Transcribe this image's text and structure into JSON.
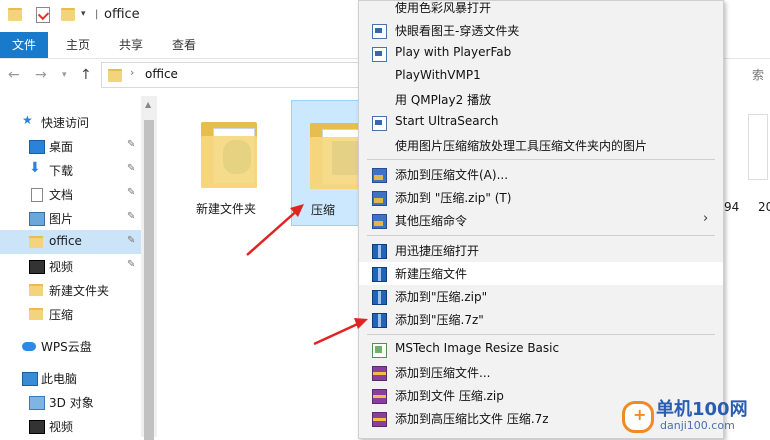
{
  "window": {
    "title": "office"
  },
  "ribbon": {
    "tabs": [
      "文件",
      "主页",
      "共享",
      "查看"
    ]
  },
  "address": {
    "path": "office",
    "search_fragment": "索"
  },
  "nav": {
    "items": [
      {
        "label": "快速访问",
        "icon": "star-icon"
      },
      {
        "label": "桌面",
        "icon": "desktop-icon",
        "pinned": true
      },
      {
        "label": "下载",
        "icon": "download-icon",
        "pinned": true
      },
      {
        "label": "文档",
        "icon": "document-icon",
        "pinned": true
      },
      {
        "label": "图片",
        "icon": "picture-icon",
        "pinned": true
      },
      {
        "label": "office",
        "icon": "folder-icon",
        "pinned": true,
        "selected": true
      },
      {
        "label": "视频",
        "icon": "video-icon",
        "pinned": true
      },
      {
        "label": "新建文件夹",
        "icon": "folder-icon"
      },
      {
        "label": "压缩",
        "icon": "folder-icon"
      },
      {
        "label": "WPS云盘",
        "icon": "cloud-icon"
      },
      {
        "label": "此电脑",
        "icon": "computer-icon"
      },
      {
        "label": "3D 对象",
        "icon": "3d-objects-icon"
      },
      {
        "label": "视频",
        "icon": "video-icon"
      }
    ]
  },
  "files": [
    {
      "name": "新建文件夹",
      "selected": false
    },
    {
      "name": "压缩",
      "selected": true
    }
  ],
  "edge_labels": [
    "94",
    "20"
  ],
  "context_menu": {
    "items": [
      {
        "label": "使用色彩风暴打开",
        "icon": "none"
      },
      {
        "label": "快眼看图王-穿透文件夹",
        "icon": "app-icon"
      },
      {
        "label": "Play with PlayerFab",
        "icon": "app-icon"
      },
      {
        "label": "PlayWithVMP1",
        "icon": "none"
      },
      {
        "label": "用 QMPlay2 播放",
        "icon": "none"
      },
      {
        "label": "Start UltraSearch",
        "icon": "app-icon"
      },
      {
        "label": "使用图片压缩缩放处理工具压缩文件夹内的图片",
        "icon": "none"
      },
      {
        "sep": true
      },
      {
        "label": "添加到压缩文件(A)...",
        "icon": "rar-icon"
      },
      {
        "label": "添加到 \"压缩.zip\" (T)",
        "icon": "rar-icon"
      },
      {
        "label": "其他压缩命令",
        "icon": "rar-icon",
        "submenu": true
      },
      {
        "sep": true
      },
      {
        "label": "用迅捷压缩打开",
        "icon": "zip-icon"
      },
      {
        "label": "新建压缩文件",
        "icon": "zip-icon",
        "highlighted": true
      },
      {
        "label": "添加到\"压缩.zip\"",
        "icon": "zip-icon"
      },
      {
        "label": "添加到\"压缩.7z\"",
        "icon": "zip-icon"
      },
      {
        "sep": true
      },
      {
        "label": "MSTech Image Resize Basic",
        "icon": "image-resize-icon"
      },
      {
        "label": "添加到压缩文件...",
        "icon": "winrar-icon"
      },
      {
        "label": "添加到文件 压缩.zip",
        "icon": "winrar-icon"
      },
      {
        "label": "添加到高压缩比文件 压缩.7z",
        "icon": "winrar-icon"
      }
    ]
  },
  "watermark": {
    "title": "单机100网",
    "sub": "danji100.com",
    "glyph": "+"
  },
  "colors": {
    "accent": "#1979ca",
    "selection": "#cce8ff",
    "arrow": "#e02424"
  }
}
